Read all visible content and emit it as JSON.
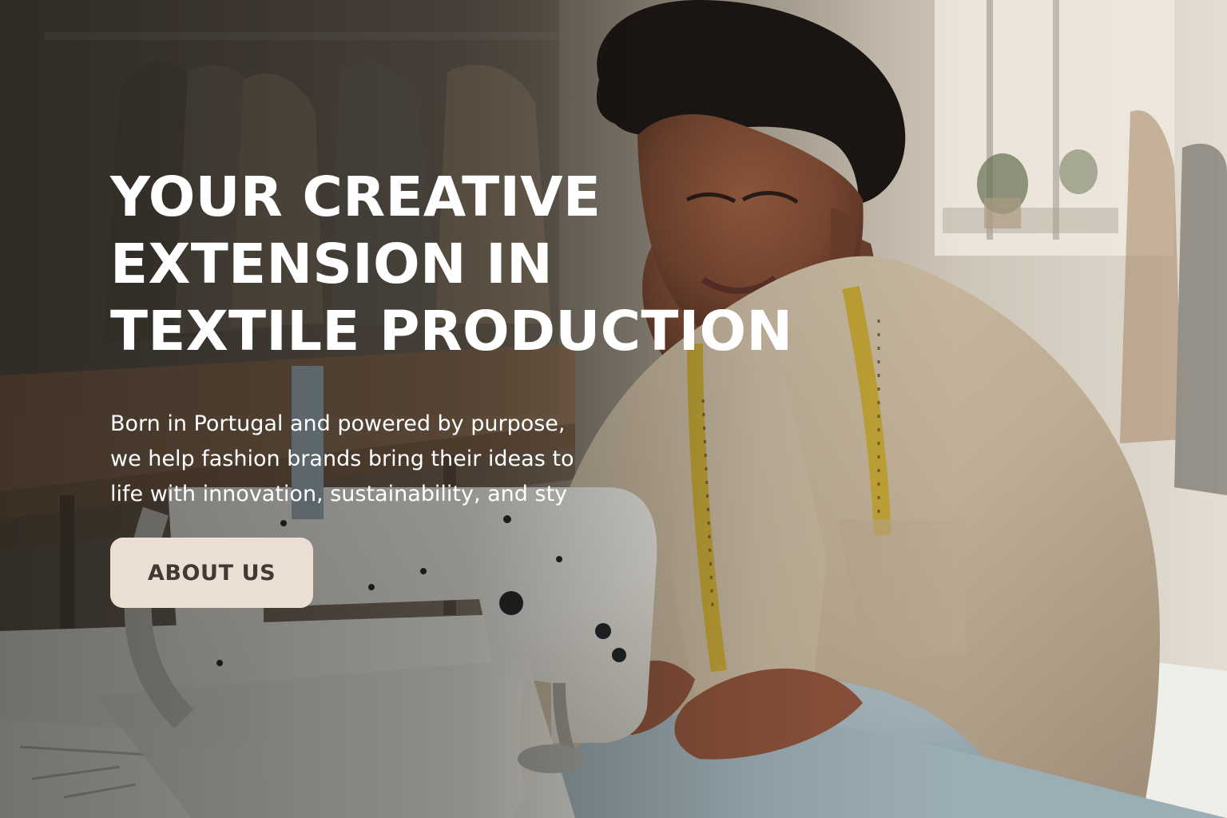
{
  "hero": {
    "headline_lines": [
      "YOUR CREATIVE",
      "EXTENSION IN",
      "TEXTILE PRODUCTION"
    ],
    "body_lines": [
      "Born in Portugal and powered by purpose,",
      "we help fashion brands bring their ideas to",
      "life with innovation, sustainability, and sty"
    ],
    "button_label": "ABOUT US"
  },
  "colors": {
    "button_background": "#eadfd2",
    "button_text": "#403a33",
    "headline_text": "#ffffff"
  },
  "icons": {
    "background_image": "textile-worker-sewing-machine-photo"
  }
}
